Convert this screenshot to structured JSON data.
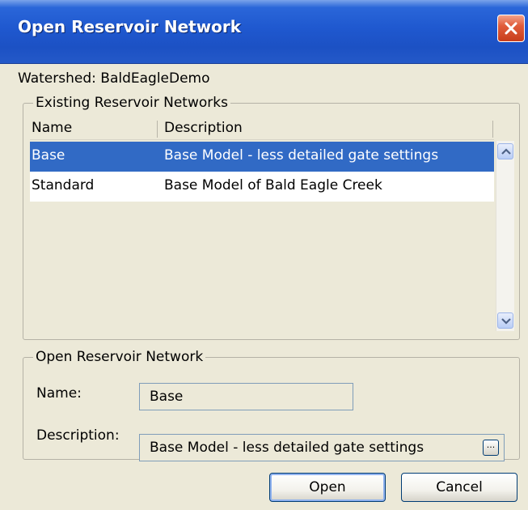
{
  "window": {
    "title": "Open Reservoir Network"
  },
  "watershed": {
    "label": "Watershed:",
    "value": "BaldEagleDemo"
  },
  "existing_networks": {
    "legend": "Existing Reservoir Networks",
    "columns": [
      "Name",
      "Description"
    ],
    "rows": [
      {
        "name": "Base",
        "description": "Base Model - less detailed gate settings",
        "selected": true
      },
      {
        "name": "Standard",
        "description": "Base Model of Bald Eagle Creek",
        "selected": false
      }
    ]
  },
  "open_network": {
    "legend": "Open Reservoir Network",
    "name_label": "Name:",
    "name_value": "Base",
    "description_label": "Description:",
    "description_value": "Base Model - less detailed gate settings",
    "ellipsis_label": "..."
  },
  "buttons": {
    "open": "Open",
    "cancel": "Cancel"
  },
  "colors": {
    "titlebar": "#1f58cf",
    "selection": "#316ac5",
    "dialog_bg": "#ece9d8",
    "close_button": "#e15d3b"
  },
  "icons": {
    "close": "close-icon",
    "scroll_up": "chevron-up-icon",
    "scroll_down": "chevron-down-icon"
  }
}
